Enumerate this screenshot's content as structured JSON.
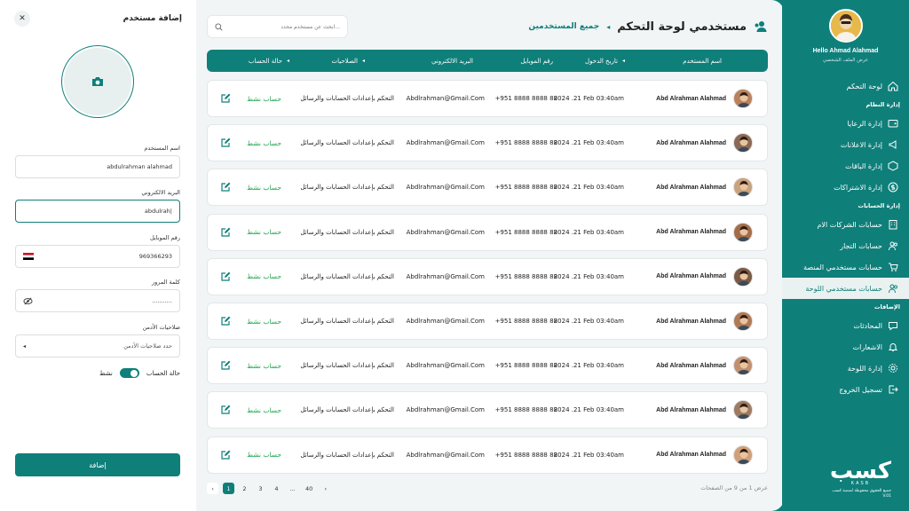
{
  "sidebar": {
    "greeting": "Hello Ahmad Alahmad",
    "view_profile": "عرض الملف الشخصي",
    "nav": [
      {
        "type": "item",
        "label": "لوحة التحكم",
        "icon": "home-icon",
        "name": "dashboard"
      },
      {
        "type": "section",
        "label": "إدارة النظام"
      },
      {
        "type": "item",
        "label": "إدارة الرعايا",
        "icon": "wallet-icon",
        "name": "sponsors"
      },
      {
        "type": "item",
        "label": "إدارة الاعلانات",
        "icon": "megaphone-icon",
        "name": "ads"
      },
      {
        "type": "item",
        "label": "إدارة الباقات",
        "icon": "package-icon",
        "name": "packages"
      },
      {
        "type": "item",
        "label": "إدارة الاشتراكات",
        "icon": "dollar-icon",
        "name": "subscriptions"
      },
      {
        "type": "section",
        "label": "إدارة الحسابات"
      },
      {
        "type": "item",
        "label": "حسابات الشركات الام",
        "icon": "building-icon",
        "name": "parent-companies"
      },
      {
        "type": "item",
        "label": "حسابات التجار",
        "icon": "users-icon",
        "name": "merchants"
      },
      {
        "type": "item",
        "label": "حسابات مستخدمي المنصة",
        "icon": "cart-icon",
        "name": "platform-users"
      },
      {
        "type": "item",
        "label": "حسابات مستخدمي اللوحة",
        "icon": "user-group-icon",
        "name": "panel-users",
        "active": true
      },
      {
        "type": "section",
        "label": "الإضافات"
      },
      {
        "type": "item",
        "label": "المحادثات",
        "icon": "chat-icon",
        "name": "chats"
      },
      {
        "type": "item",
        "label": "الاشعارات",
        "icon": "bell-icon",
        "name": "notifications"
      },
      {
        "type": "item",
        "label": "إدارة اللوحة",
        "icon": "settings-icon",
        "name": "panel-settings"
      },
      {
        "type": "item",
        "label": "تسجيل الخروج",
        "icon": "logout-icon",
        "name": "logout"
      }
    ],
    "brand": {
      "logo": "كسب",
      "sub": "KASB",
      "rights": "جميع الحقوق محفوظة لمنصة كسب",
      "version": "V.01"
    }
  },
  "header": {
    "title": "مستخدمي لوحة التحكم",
    "breadcrumb": "جميع المستخدمين",
    "search_placeholder": "ابحث عن مستخدم محدد..."
  },
  "table": {
    "columns": {
      "name": "اسم المستخدم",
      "date": "تاريخ الدخول",
      "mobile": "رقم الموبايل",
      "email": "البريد الالكتروني",
      "permissions": "الصلاحيات",
      "status": "حالة الحساب"
    },
    "rows": [
      {
        "name": "Abd Alrahman Alahmad",
        "date": "2024 .21 Feb   03:40am",
        "mobile": "+951 8888 8888 88",
        "email": "Abdlrahman@Gmail.Com",
        "permissions": "التحكم بإعدادات الحسابات والرسائل",
        "status": "حساب نشط"
      },
      {
        "name": "Abd Alrahman Alahmad",
        "date": "2024 .21 Feb   03:40am",
        "mobile": "+951 8888 8888 88",
        "email": "Abdlrahman@Gmail.Com",
        "permissions": "التحكم بإعدادات الحسابات والرسائل",
        "status": "حساب نشط"
      },
      {
        "name": "Abd Alrahman Alahmad",
        "date": "2024 .21 Feb   03:40am",
        "mobile": "+951 8888 8888 88",
        "email": "Abdlrahman@Gmail.Com",
        "permissions": "التحكم بإعدادات الحسابات والرسائل",
        "status": "حساب نشط"
      },
      {
        "name": "Abd Alrahman Alahmad",
        "date": "2024 .21 Feb   03:40am",
        "mobile": "+951 8888 8888 88",
        "email": "Abdlrahman@Gmail.Com",
        "permissions": "التحكم بإعدادات الحسابات والرسائل",
        "status": "حساب نشط"
      },
      {
        "name": "Abd Alrahman Alahmad",
        "date": "2024 .21 Feb   03:40am",
        "mobile": "+951 8888 8888 88",
        "email": "Abdlrahman@Gmail.Com",
        "permissions": "التحكم بإعدادات الحسابات والرسائل",
        "status": "حساب نشط"
      },
      {
        "name": "Abd Alrahman Alahmad",
        "date": "2024 .21 Feb   03:40am",
        "mobile": "+951 8888 8888 88",
        "email": "Abdlrahman@Gmail.Com",
        "permissions": "التحكم بإعدادات الحسابات والرسائل",
        "status": "حساب نشط"
      },
      {
        "name": "Abd Alrahman Alahmad",
        "date": "2024 .21 Feb   03:40am",
        "mobile": "+951 8888 8888 88",
        "email": "Abdlrahman@Gmail.Com",
        "permissions": "التحكم بإعدادات الحسابات والرسائل",
        "status": "حساب نشط"
      },
      {
        "name": "Abd Alrahman Alahmad",
        "date": "2024 .21 Feb   03:40am",
        "mobile": "+951 8888 8888 88",
        "email": "Abdlrahman@Gmail.Com",
        "permissions": "التحكم بإعدادات الحسابات والرسائل",
        "status": "حساب نشط"
      },
      {
        "name": "Abd Alrahman Alahmad",
        "date": "2024 .21 Feb   03:40am",
        "mobile": "+951 8888 8888 88",
        "email": "Abdlrahman@Gmail.Com",
        "permissions": "التحكم بإعدادات الحسابات والرسائل",
        "status": "حساب نشط"
      }
    ]
  },
  "pagination": {
    "info": "عرض 1 من 9 من الصفحات",
    "pages": [
      "1",
      "2",
      "3",
      "4",
      "...",
      "40"
    ],
    "current": "1"
  },
  "form": {
    "title": "إضافة مستخدم",
    "username_label": "اسم المستخدم",
    "username_value": "abdulrahman alahmad",
    "email_label": "البريد الالكتروني",
    "email_value": "abdulrah|",
    "mobile_label": "رقم الموبايل",
    "mobile_value": "969366293",
    "password_label": "كلمة المرور",
    "password_value": "...........",
    "permissions_label": "صلاحيات الأدمن",
    "permissions_placeholder": "حدد صلاحيات الأدمن",
    "status_label": "حالة الحساب",
    "status_value": "نشط",
    "submit": "إضافة"
  },
  "colors": {
    "accent": "#0f7f7a",
    "active_status": "#1aa34a",
    "background": "#f1f5f6"
  }
}
